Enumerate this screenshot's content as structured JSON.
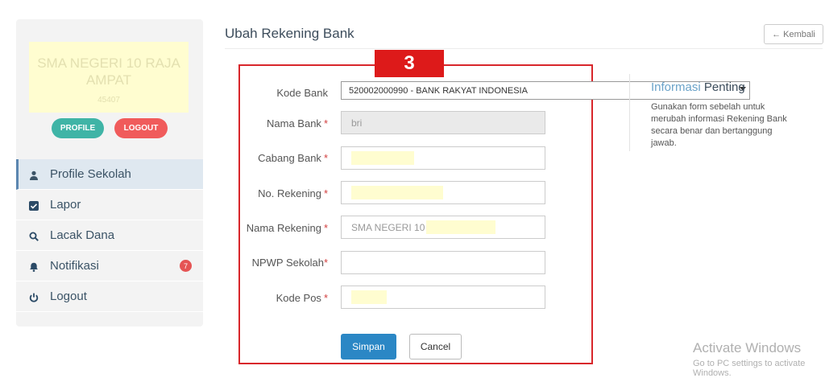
{
  "sidebar": {
    "school_name": "SMA NEGERI 10 RAJA AMPAT",
    "school_sub": "45407",
    "profile_button": "PROFILE",
    "logout_button": "LOGOUT",
    "menu": [
      {
        "label": "Profile Sekolah",
        "icon": "user-icon",
        "active": true
      },
      {
        "label": "Lapor",
        "icon": "checkbox-icon"
      },
      {
        "label": "Lacak Dana",
        "icon": "search-icon"
      },
      {
        "label": "Notifikasi",
        "icon": "bell-icon",
        "badge": "7"
      },
      {
        "label": "Logout",
        "icon": "power-icon"
      }
    ]
  },
  "header": {
    "title": "Ubah Rekening Bank",
    "back_button": "Kembali"
  },
  "step_badge": "3",
  "form": {
    "kode_bank": {
      "label": "Kode Bank",
      "value": "520002000990 - BANK RAKYAT INDONESIA"
    },
    "nama_bank": {
      "label": "Nama Bank",
      "value": "bri"
    },
    "cabang_bank": {
      "label": "Cabang Bank"
    },
    "no_rekening": {
      "label": "No. Rekening"
    },
    "nama_rekening": {
      "label": "Nama Rekening",
      "value": "SMA NEGERI 10"
    },
    "npwp": {
      "label": "NPWP Sekolah"
    },
    "kode_pos": {
      "label": "Kode Pos"
    },
    "required_mark": "*",
    "submit_label": "Simpan",
    "cancel_label": "Cancel"
  },
  "info": {
    "title_a": "Informasi",
    "title_b": "Penting",
    "body": "Gunakan form sebelah untuk merubah informasi Rekening Bank secara benar dan bertanggung jawab."
  },
  "watermark": {
    "line1": "Activate Windows",
    "line2": "Go to PC settings to activate Windows."
  },
  "colors": {
    "accent": "#2b87c5",
    "profile": "#3fb4a6",
    "logout": "#f05b5b",
    "frame": "#d8262b"
  }
}
